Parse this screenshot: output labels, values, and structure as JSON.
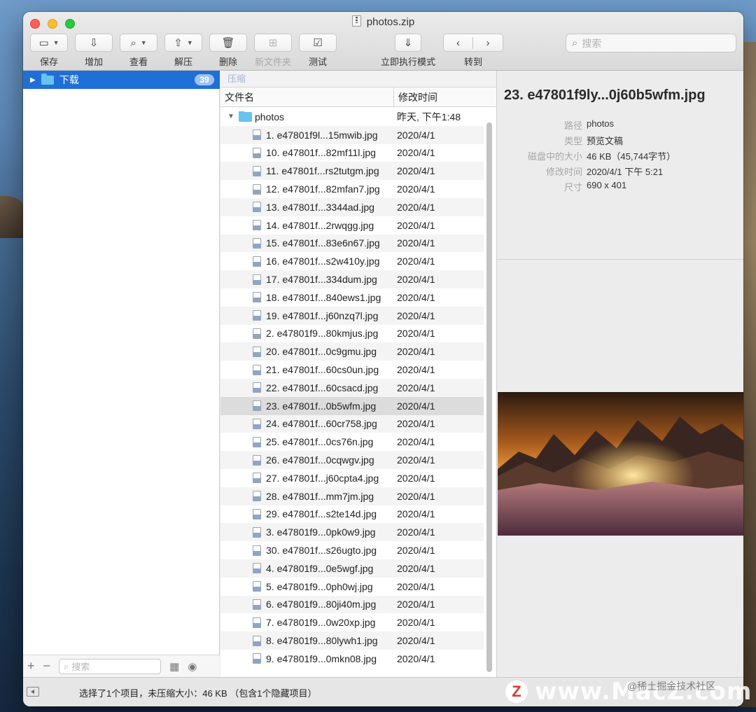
{
  "window": {
    "title": "photos.zip"
  },
  "toolbar": {
    "save": "保存",
    "add": "增加",
    "view": "查看",
    "extract": "解压",
    "delete": "删除",
    "new_folder": "新文件夹",
    "test": "测试",
    "instant_mode": "立即执行模式",
    "goto": "转到",
    "search_placeholder": "搜索"
  },
  "sidebar": {
    "item_label": "下载",
    "item_count": "39",
    "search_placeholder": "搜索"
  },
  "list": {
    "breadcrumb": "压缩",
    "col_name": "文件名",
    "col_modified": "修改时间",
    "folder": {
      "name": "photos",
      "modified": "昨天, 下午1:48"
    },
    "files": [
      {
        "name": "1. e47801f9l...15mwib.jpg",
        "modified": "2020/4/1"
      },
      {
        "name": "10. e47801f...82mf11l.jpg",
        "modified": "2020/4/1"
      },
      {
        "name": "11. e47801f...rs2tutgm.jpg",
        "modified": "2020/4/1"
      },
      {
        "name": "12. e47801f...82mfan7.jpg",
        "modified": "2020/4/1"
      },
      {
        "name": "13. e47801f...3344ad.jpg",
        "modified": "2020/4/1"
      },
      {
        "name": "14. e47801f...2rwqgg.jpg",
        "modified": "2020/4/1"
      },
      {
        "name": "15. e47801f...83e6n67.jpg",
        "modified": "2020/4/1"
      },
      {
        "name": "16. e47801f...s2w410y.jpg",
        "modified": "2020/4/1"
      },
      {
        "name": "17. e47801f...334dum.jpg",
        "modified": "2020/4/1"
      },
      {
        "name": "18. e47801f...840ews1.jpg",
        "modified": "2020/4/1"
      },
      {
        "name": "19. e47801f...j60nzq7l.jpg",
        "modified": "2020/4/1"
      },
      {
        "name": "2. e47801f9...80kmjus.jpg",
        "modified": "2020/4/1"
      },
      {
        "name": "20. e47801f...0c9gmu.jpg",
        "modified": "2020/4/1"
      },
      {
        "name": "21. e47801f...60cs0un.jpg",
        "modified": "2020/4/1"
      },
      {
        "name": "22. e47801f...60csacd.jpg",
        "modified": "2020/4/1"
      },
      {
        "name": "23. e47801f...0b5wfm.jpg",
        "modified": "2020/4/1"
      },
      {
        "name": "24. e47801f...60cr758.jpg",
        "modified": "2020/4/1"
      },
      {
        "name": "25. e47801f...0cs76n.jpg",
        "modified": "2020/4/1"
      },
      {
        "name": "26. e47801f...0cqwgv.jpg",
        "modified": "2020/4/1"
      },
      {
        "name": "27. e47801f...j60cpta4.jpg",
        "modified": "2020/4/1"
      },
      {
        "name": "28. e47801f...mm7jm.jpg",
        "modified": "2020/4/1"
      },
      {
        "name": "29. e47801f...s2te14d.jpg",
        "modified": "2020/4/1"
      },
      {
        "name": "3. e47801f9...0pk0w9.jpg",
        "modified": "2020/4/1"
      },
      {
        "name": "30. e47801f...s26ugto.jpg",
        "modified": "2020/4/1"
      },
      {
        "name": "4. e47801f9...0e5wgf.jpg",
        "modified": "2020/4/1"
      },
      {
        "name": "5. e47801f9...0ph0wj.jpg",
        "modified": "2020/4/1"
      },
      {
        "name": "6. e47801f9...80ji40m.jpg",
        "modified": "2020/4/1"
      },
      {
        "name": "7. e47801f9...0w20xp.jpg",
        "modified": "2020/4/1"
      },
      {
        "name": "8. e47801f9...80lywh1.jpg",
        "modified": "2020/4/1"
      },
      {
        "name": "9. e47801f9...0mkn08.jpg",
        "modified": "2020/4/1"
      }
    ],
    "selected_index": 15
  },
  "info": {
    "title": "23. e47801f9ly...0j60b5wfm.jpg",
    "path_label": "路径",
    "path": "photos",
    "type_label": "类型",
    "type": "预览文稿",
    "size_label": "磁盘中的大小",
    "size": "46 KB（45,744字节）",
    "modified_label": "修改时间",
    "modified": "2020/4/1 下午 5:21",
    "dimensions_label": "尺寸",
    "dimensions": "690 x 401"
  },
  "status": {
    "text": "选择了1个项目，未压缩大小：46 KB （包含1个隐藏项目）"
  },
  "watermark": {
    "brand": "www.MacZ.com",
    "credit": "@稀土掘金技术社区"
  }
}
